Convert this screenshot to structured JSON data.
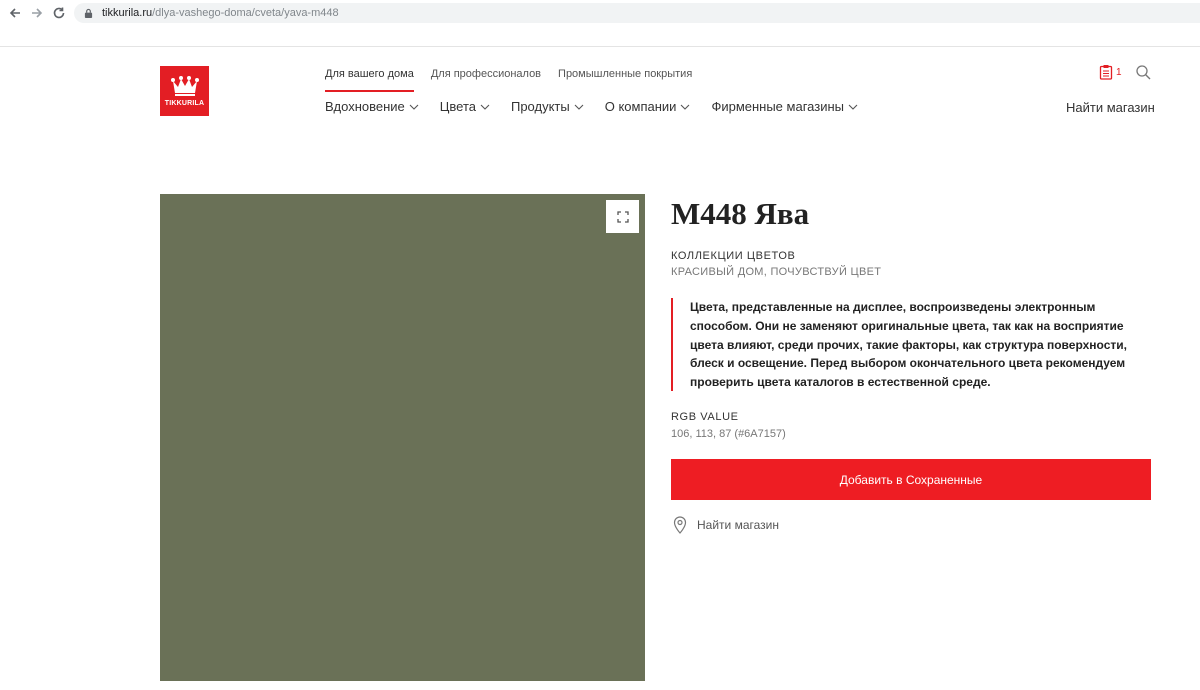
{
  "browser": {
    "url_host": "tikkurila.ru",
    "url_path": "/dlya-vashego-doma/cveta/yava-m448"
  },
  "header": {
    "logo_text": "TIKKURILA",
    "top_links": [
      {
        "label": "Для вашего дома",
        "active": true
      },
      {
        "label": "Для профессионалов",
        "active": false
      },
      {
        "label": "Промышленные покрытия",
        "active": false
      }
    ],
    "nav": [
      {
        "label": "Вдохновение"
      },
      {
        "label": "Цвета"
      },
      {
        "label": "Продукты"
      },
      {
        "label": "О компании"
      },
      {
        "label": "Фирменные магазины"
      }
    ],
    "saved_count": "1",
    "find_store": "Найти магазин"
  },
  "color": {
    "title": "M448 Ява",
    "collections_label": "КОЛЛЕКЦИИ ЦВЕТОВ",
    "collections_value": "КРАСИВЫЙ ДОМ, ПОЧУВСТВУЙ ЦВЕТ",
    "notice": "Цвета, представленные на дисплее, воспроизведены электронным способом. Они не заменяют оригинальные цвета, так как на восприятие цвета влияют, среди прочих, такие факторы, как структура поверхности, блеск и освещение. Перед выбором окончательного цвета рекомендуем проверить цвета каталогов в естественной среде.",
    "rgb_label": "RGB VALUE",
    "rgb_value": "106, 113, 87 (#6A7157)",
    "swatch_hex": "#6A7157",
    "save_button": "Добавить в Сохраненные",
    "find_store": "Найти магазин"
  },
  "colors": {
    "accent": "#E31E24"
  },
  "icons": {
    "back": "back-arrow-icon",
    "forward": "forward-arrow-icon",
    "reload": "reload-icon",
    "lock": "lock-icon",
    "saved": "clipboard-icon",
    "search": "search-icon",
    "expand": "expand-icon",
    "pin": "location-pin-icon",
    "chevron": "chevron-down-icon"
  }
}
